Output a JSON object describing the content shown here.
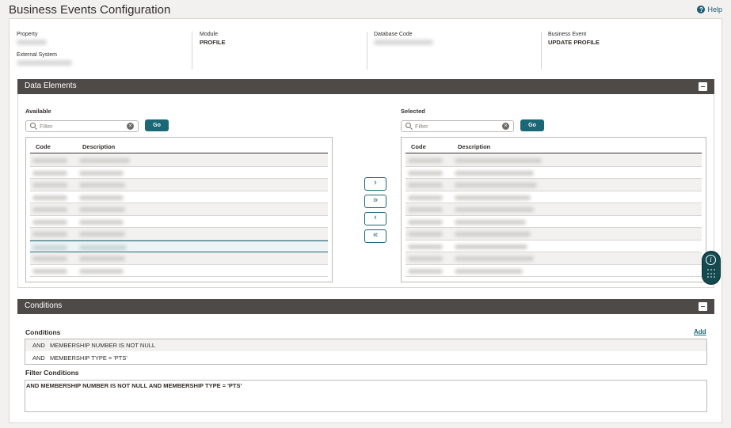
{
  "page": {
    "title": "Business Events Configuration",
    "help_label": "Help"
  },
  "info": {
    "property_label": "Property",
    "external_system_label": "External System",
    "module_label": "Module",
    "module_value": "PROFILE",
    "database_code_label": "Database Code",
    "business_event_label": "Business Event",
    "business_event_value": "UPDATE PROFILE"
  },
  "data_elements": {
    "title": "Data Elements",
    "available": {
      "label": "Available",
      "filter_placeholder": "Filter",
      "go_label": "Go",
      "columns": {
        "code": "Code",
        "description": "Description"
      }
    },
    "selected": {
      "label": "Selected",
      "filter_placeholder": "Filter",
      "go_label": "Go",
      "columns": {
        "code": "Code",
        "description": "Description"
      }
    },
    "move_buttons": {
      "move_right": "›",
      "move_all_right": "»",
      "move_left": "‹",
      "move_all_left": "«"
    }
  },
  "conditions_panel": {
    "title": "Conditions",
    "conditions_label": "Conditions",
    "add_label": "Add",
    "rows": [
      {
        "op": "AND",
        "text": "MEMBERSHIP NUMBER IS NOT NULL"
      },
      {
        "op": "AND",
        "text": "MEMBERSHIP TYPE = 'PTS'"
      }
    ],
    "filter_conditions_label": "Filter Conditions",
    "filter_conditions_text": "AND MEMBERSHIP NUMBER IS NOT NULL AND MEMBERSHIP TYPE = 'PTS'"
  },
  "colors": {
    "accent": "#1a6775",
    "header_bar": "#4d4a47",
    "background": "#f2f1ef"
  },
  "icons": {
    "help": "help-circle-icon",
    "search": "search-icon",
    "clear": "clear-icon",
    "collapse": "minus-icon",
    "info": "info-icon",
    "keypad": "keypad-icon"
  }
}
